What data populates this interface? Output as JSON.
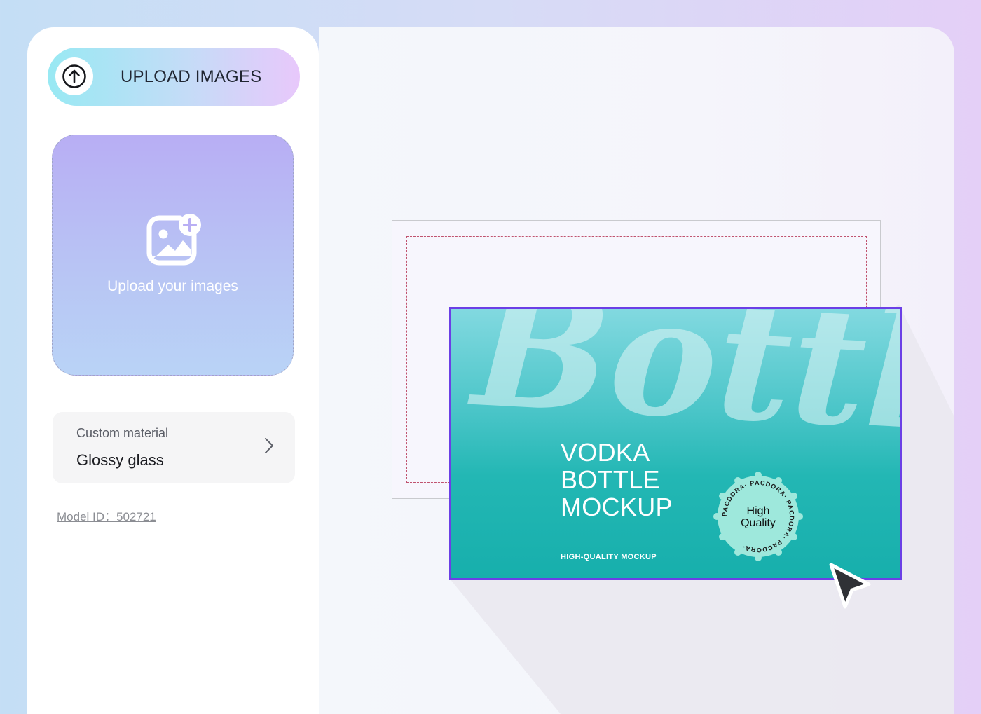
{
  "sidebar": {
    "upload_button": {
      "label": "UPLOAD IMAGES",
      "icon": "arrow-up-circle-icon"
    },
    "dropzone": {
      "label": "Upload your images",
      "icon": "add-image-icon"
    },
    "material": {
      "label": "Custom material",
      "value": "Glossy glass",
      "icon": "chevron-right-icon"
    },
    "model_id": {
      "text": "Model ID：502721"
    }
  },
  "canvas": {
    "card": {
      "background_word": "Bottle",
      "headline": [
        "VODKA",
        "BOTTLE",
        "MOCKUP"
      ],
      "tagline": "HIGH-QUALITY MOCKUP",
      "seal": {
        "line1": "High",
        "line2": "Quality",
        "ring_text": "PACDORA· PACDORA· PACDORA· PACDORA·"
      }
    },
    "cursor_icon": "pointer-arrow-icon"
  },
  "colors": {
    "accent_selection": "#6b3fe6",
    "card_teal": "#17afac",
    "seal_mint": "#9ee8dc",
    "bleed_line": "#c0536f"
  }
}
